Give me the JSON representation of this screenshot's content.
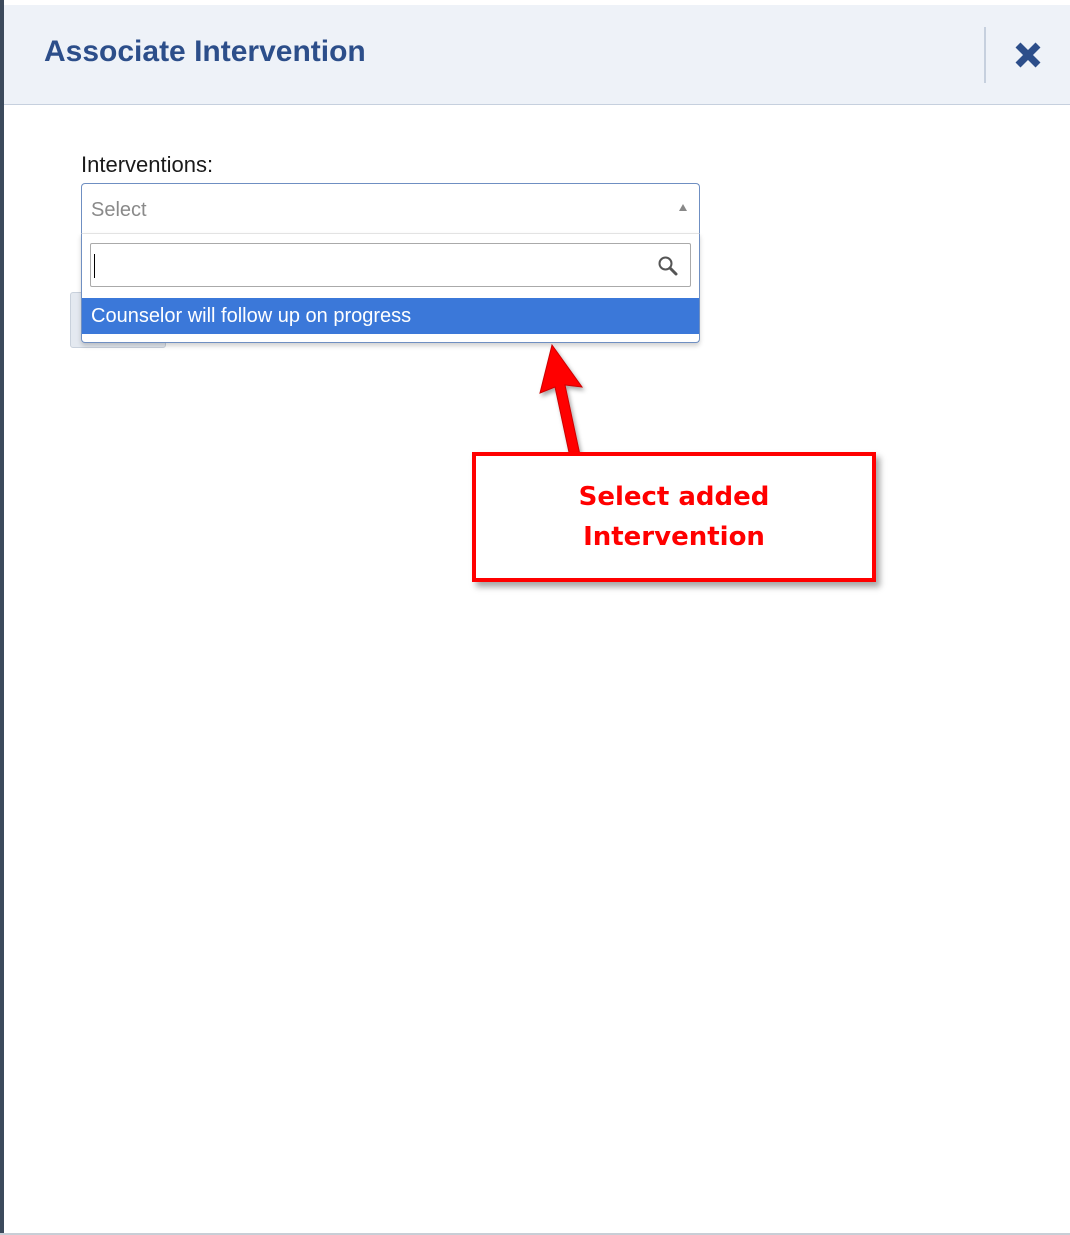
{
  "dialog": {
    "title": "Associate Intervention",
    "close_icon": "close-x-icon"
  },
  "form": {
    "interventions_label": "Interventions:",
    "select": {
      "placeholder": "Select",
      "search_value": "",
      "search_icon": "search-icon",
      "options": [
        {
          "label": "Counselor will follow up on progress",
          "highlighted": true
        }
      ]
    }
  },
  "annotation": {
    "text": "Select added\nIntervention",
    "color": "#ff0000"
  },
  "colors": {
    "title": "#2c4e8a",
    "header_bg": "#eef2f8",
    "highlight": "#3b78d9"
  }
}
